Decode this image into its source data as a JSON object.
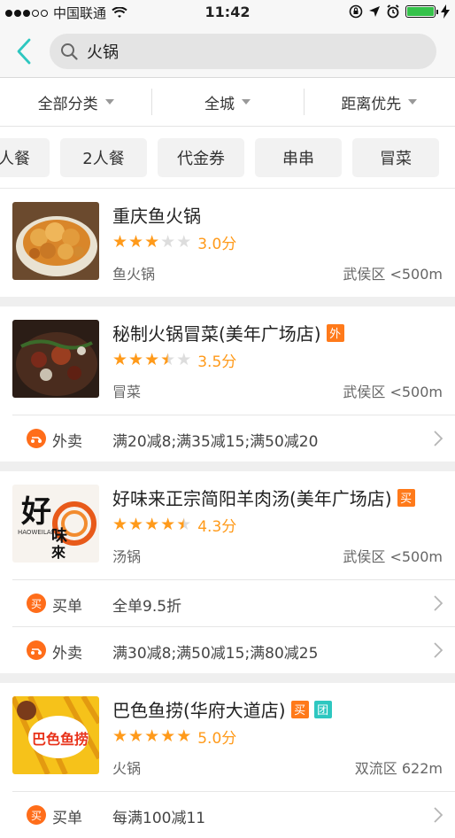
{
  "status_bar": {
    "carrier": "中国联通",
    "time": "11:42"
  },
  "search": {
    "query": "火锅"
  },
  "filters": [
    {
      "label": "全部分类"
    },
    {
      "label": "全城"
    },
    {
      "label": "距离优先"
    }
  ],
  "tags": [
    "单人餐",
    "2人餐",
    "代金券",
    "串串",
    "冒菜"
  ],
  "shops": [
    {
      "name": "重庆鱼火锅",
      "badges": [],
      "rating": 3.0,
      "score_text": "3.0分",
      "category": "鱼火锅",
      "location": "武侯区 <500m",
      "promos": []
    },
    {
      "name": "秘制火锅冒菜(美年广场店)",
      "badges": [
        {
          "text": "外",
          "color": "#ff7a1a"
        }
      ],
      "rating": 3.5,
      "score_text": "3.5分",
      "category": "冒菜",
      "location": "武侯区 <500m",
      "promos": [
        {
          "icon": "delivery-icon",
          "label": "外卖",
          "text": "满20减8;满35减15;满50减20"
        }
      ]
    },
    {
      "name": "好味来正宗简阳羊肉汤(美年广场店)",
      "badges": [
        {
          "text": "买",
          "color": "#ff7a1a"
        }
      ],
      "rating": 4.5,
      "score_text": "4.3分",
      "category": "汤锅",
      "location": "武侯区 <500m",
      "promos": [
        {
          "icon": "buy-icon",
          "label": "买单",
          "text": "全单9.5折"
        },
        {
          "icon": "delivery-icon",
          "label": "外卖",
          "text": "满30减8;满50减15;满80减25"
        }
      ]
    },
    {
      "name": "巴色鱼捞(华府大道店)",
      "badges": [
        {
          "text": "买",
          "color": "#ff7a1a"
        },
        {
          "text": "团",
          "color": "#2ec7c0"
        }
      ],
      "rating": 5.0,
      "score_text": "5.0分",
      "category": "火锅",
      "location": "双流区 622m",
      "promos": [
        {
          "icon": "buy-icon",
          "label": "买单",
          "text": "每满100减11"
        }
      ]
    }
  ],
  "logo_texts": {
    "haoweilai_pinyin": "HAOWEILAI",
    "haoweilai_chars": "好味來",
    "basa_chars": "巴色鱼捞"
  },
  "colors": {
    "accent": "#2ec7c0",
    "star": "#ff9a1a",
    "badge_orange": "#ff7a1a"
  }
}
